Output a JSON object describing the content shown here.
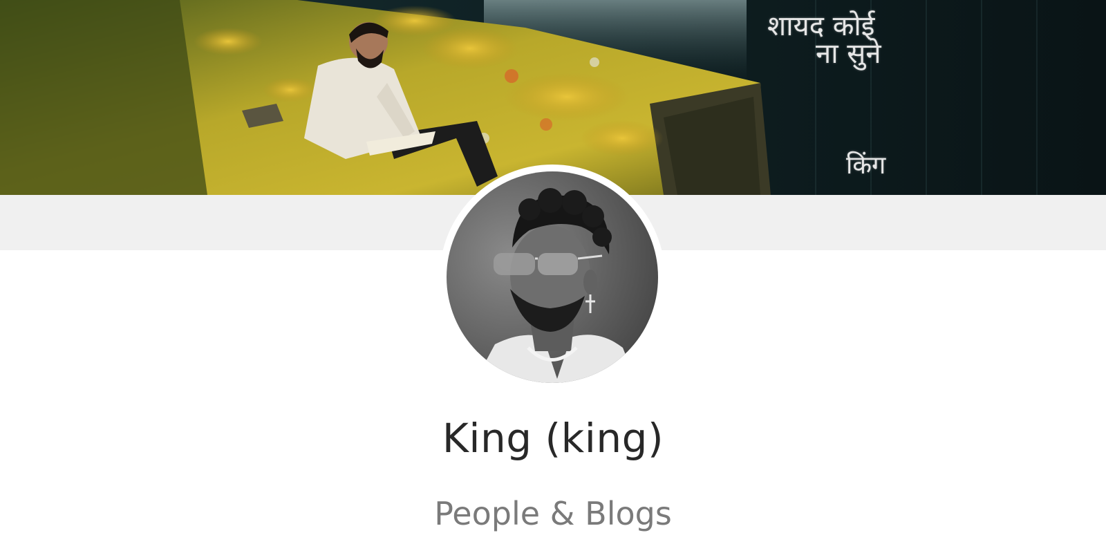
{
  "banner": {
    "title_line_1": "शायद कोई",
    "title_line_2": "ना सुने",
    "artist": "किंग"
  },
  "profile": {
    "name": "King (king)",
    "category": "People & Blogs"
  },
  "colors": {
    "strip": "#f0f0f0",
    "name_text": "#282828",
    "category_text": "#7a7a7a"
  }
}
